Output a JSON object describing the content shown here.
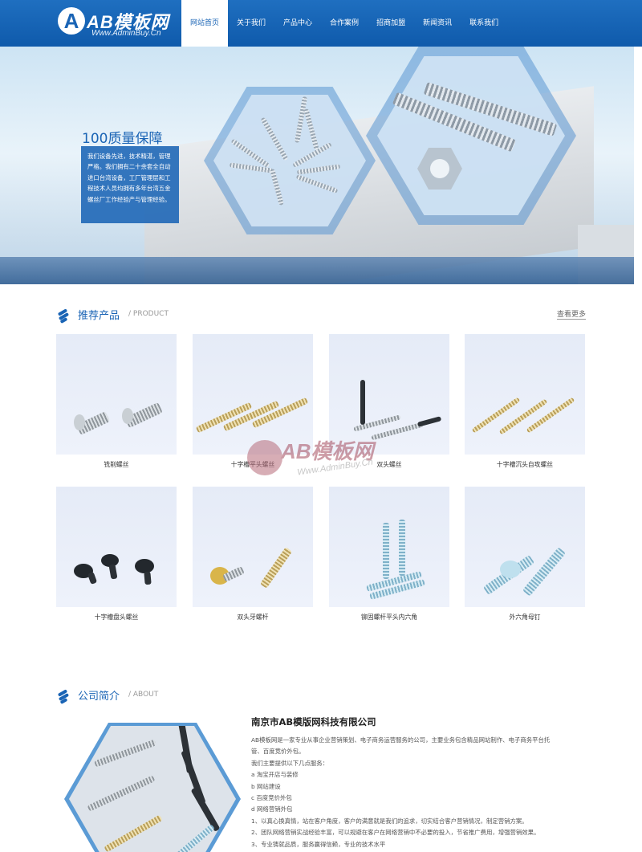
{
  "header": {
    "logo_mark": "A",
    "logo_text": "AB模板网",
    "logo_sub": "Www.AdminBuy.Cn",
    "nav": [
      "网站首页",
      "关于我们",
      "产品中心",
      "合作案例",
      "招商加盟",
      "新闻资讯",
      "联系我们"
    ],
    "active_nav": "网站首页"
  },
  "hero": {
    "title": "100质量保障",
    "text": "我们设备先进，技术精湛，管理严格。我们拥有二十余套全自动进口台湾设备，工厂管理层和工程技术人员均拥有多年台湾五金螺丝厂工作经验产与管理经验。"
  },
  "products_section": {
    "title": "推荐产品",
    "subtitle": "/ PRODUCT",
    "more": "查看更多",
    "items": [
      {
        "name": "铣削螺丝",
        "icon": "milled-screw-icon"
      },
      {
        "name": "十字槽平头螺丝",
        "icon": "phillips-flat-screw-icon"
      },
      {
        "name": "双头螺丝",
        "icon": "double-end-screw-icon"
      },
      {
        "name": "十字槽沉头自攻螺丝",
        "icon": "countersunk-tapping-screw-icon"
      },
      {
        "name": "十字槽盘头螺丝",
        "icon": "pan-head-screw-icon"
      },
      {
        "name": "双头牙螺杆",
        "icon": "stud-bolt-icon"
      },
      {
        "name": "铆固螺杆平头内六角",
        "icon": "hex-socket-bolt-icon"
      },
      {
        "name": "外六角母钉",
        "icon": "hex-head-bolt-icon"
      }
    ]
  },
  "watermark": {
    "text": "AB模板网",
    "sub": "Www.AdminBuy.Cn"
  },
  "about_section": {
    "title": "公司简介",
    "subtitle": "/ ABOUT",
    "company": "南京市AB模版网科技有限公司",
    "lines": [
      "AB模板网是一家专业从事企业营销策划、电子商务运营服务的公司，主要业务包含精品网站制作、电子商务平台托",
      "管、百度竞价外包。",
      "我们主要提供以下几点服务：",
      "a  淘宝开店与装修",
      "b  网站建设",
      "c  百度竞价外包",
      "d  网络营销外包",
      "1、以真心换真情，站在客户角度，客户的满意就是我们的追求，切实结合客户营销情况，制定营销方案。",
      "2、团队网络营销实战经验丰富，可以规避在客户在网络营销中不必要的投入，节省推广费用，增强营销效果。",
      "3、专业铸就品质，服务赢得信赖，专业的技术水平"
    ]
  },
  "colors": {
    "brand_blue": "#1a64b5",
    "active_nav_bg": "#ffffff"
  }
}
